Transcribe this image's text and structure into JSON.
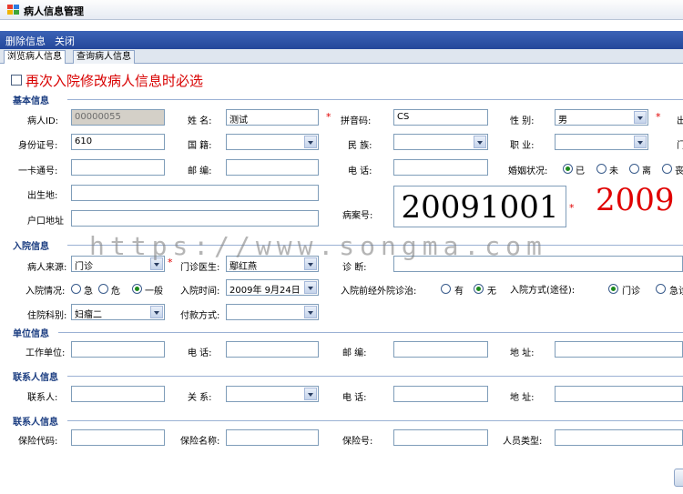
{
  "window": {
    "title": "病人信息管理"
  },
  "menu": {
    "delete": "删除信息",
    "close": "关闭"
  },
  "tabs": [
    "浏览病人信息",
    "查询病人信息"
  ],
  "notice": "再次入院修改病人信息时必选",
  "sections": {
    "basic": "基本信息",
    "admission": "入院信息",
    "work": "单位信息",
    "contact": "联系人信息",
    "insurance": "联系人信息"
  },
  "basic": {
    "patient_id_label": "病人ID:",
    "patient_id": "00000055",
    "name_label": "姓 名:",
    "name": "测试",
    "pinyin_label": "拼音码:",
    "pinyin": "CS",
    "gender_label": "性 别:",
    "gender": "男",
    "birth_cut": "出",
    "idcard_label": "身份证号:",
    "idcard": "610",
    "nation_label": "国 籍:",
    "nation": "",
    "ethnic_label": "民 族:",
    "ethnic": "",
    "job_label": "职 业:",
    "job": "",
    "right_cut": "门",
    "card_label": "一卡通号:",
    "card": "",
    "zip_label": "邮 编:",
    "zip": "",
    "phone_label": "电 话:",
    "phone": "",
    "marital_label": "婚姻状况:",
    "marital_opts": [
      "已",
      "未",
      "离",
      "丧"
    ],
    "marital_selected": 0,
    "birthplace_label": "出生地:",
    "birthplace": "",
    "hukou_label": "户口地址",
    "hukou": "",
    "record_label": "病案号:",
    "record_no": "20091001",
    "record_no_red": "2009"
  },
  "admission": {
    "source_label": "病人来源:",
    "source": "门诊",
    "doctor_label": "门诊医生:",
    "doctor": "鄢红燕",
    "diag_label": "诊 断:",
    "diag": "",
    "cond_label": "入院情况:",
    "cond_opts": [
      "急",
      "危",
      "一般"
    ],
    "cond_selected": 2,
    "time_label": "入院时间:",
    "time": "2009年 9月24日",
    "pre_label": "入院前经外院诊治:",
    "pre_opts": [
      "有",
      "无"
    ],
    "pre_selected": 1,
    "way_label": "入院方式(途径):",
    "way_opts": [
      "门诊",
      "急诊"
    ],
    "way_selected": 0,
    "dept_label": "住院科别:",
    "dept": "妇瘤二",
    "pay_label": "付款方式:",
    "pay": ""
  },
  "work": {
    "unit_label": "工作单位:",
    "unit": "",
    "phone_label": "电 话:",
    "phone": "",
    "zip_label": "邮 编:",
    "zip": "",
    "addr_label": "地 址:",
    "addr": ""
  },
  "contact": {
    "person_label": "联系人:",
    "person": "",
    "relation_label": "关 系:",
    "relation": "",
    "phone_label": "电 话:",
    "phone": "",
    "addr_label": "地 址:",
    "addr": ""
  },
  "insurance": {
    "code_label": "保险代码:",
    "code": "",
    "name_label": "保险名称:",
    "name": "",
    "no_label": "保险号:",
    "no": "",
    "type_label": "人员类型:",
    "type": ""
  },
  "watermark": "https://www.songma.com",
  "colors": {
    "menubar": "#2f56a8",
    "required": "#e00000",
    "section": "#1a3c80"
  }
}
